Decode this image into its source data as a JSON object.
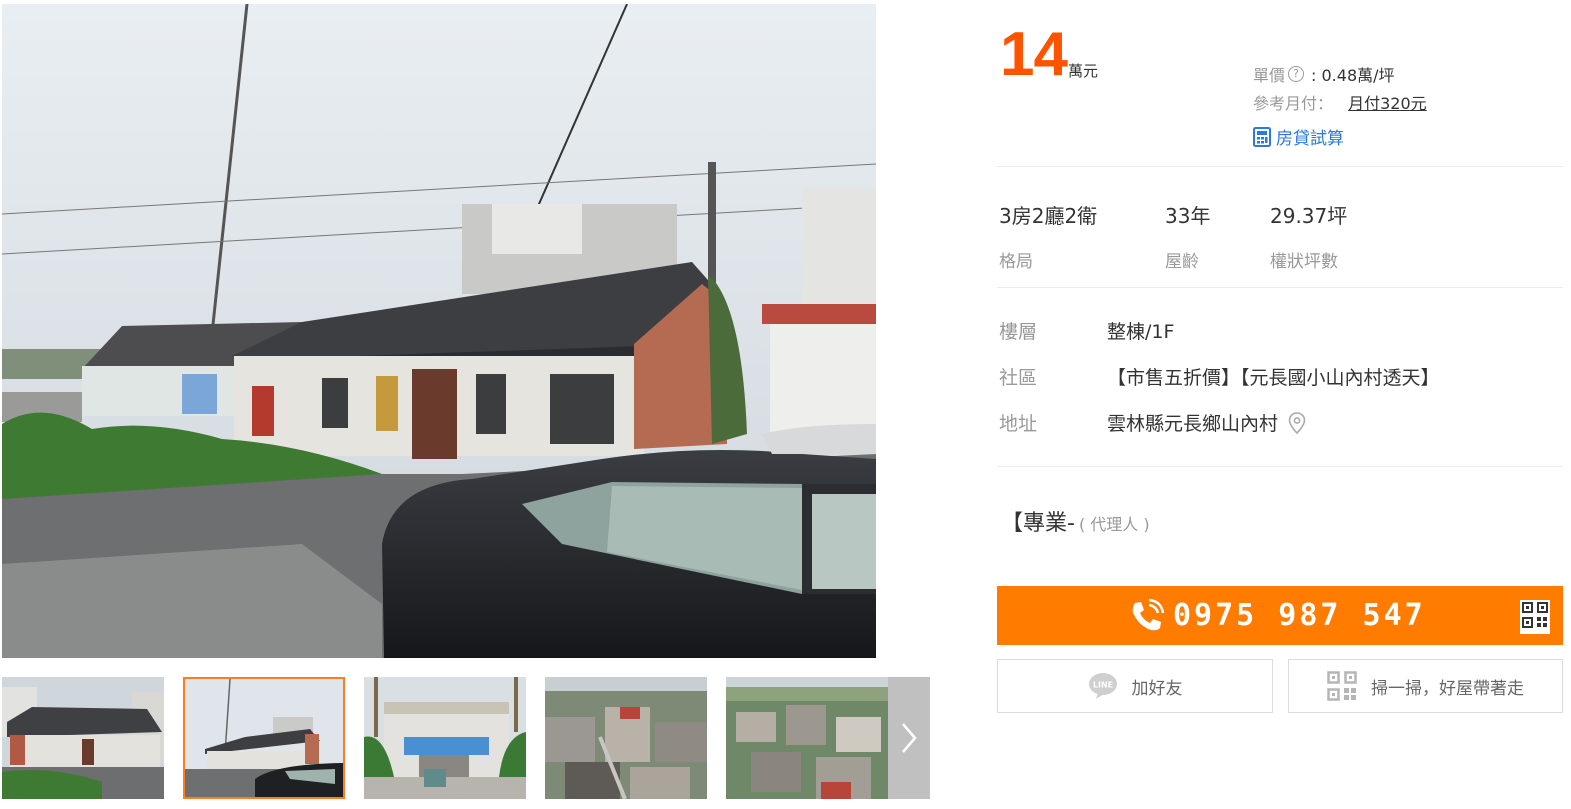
{
  "price": {
    "amount": "14",
    "unit": "萬元",
    "unit_price_label": "單價",
    "unit_price_value": ": 0.48萬/坪",
    "monthly_label": "參考月付：",
    "monthly_value": "月付320元",
    "loan_calc": "房貸試算"
  },
  "specs": [
    {
      "value": "3房2廳2衛",
      "label": "格局"
    },
    {
      "value": "33年",
      "label": "屋齡"
    },
    {
      "value": "29.37坪",
      "label": "權狀坪數"
    }
  ],
  "details": {
    "floor_label": "樓層",
    "floor_value": "整棟/1F",
    "community_label": "社區",
    "community_value": "【市售五折價】【元長國小山內村透天】",
    "address_label": "地址",
    "address_value": "雲林縣元長鄉山內村"
  },
  "agent": {
    "name": "【專業-",
    "role": "( 代理人 )"
  },
  "contact": {
    "phone": "0975 987 547",
    "line_button": "加好友",
    "scan_button": "掃一掃，好屋帶著走"
  },
  "colors": {
    "price": "#ff5300",
    "accent": "#ff7c00",
    "link": "#2b78e4"
  },
  "icons": [
    "help-icon",
    "calculator-icon",
    "map-pin-icon",
    "phone-icon",
    "qr-code-icon",
    "line-icon",
    "chevron-right-icon"
  ]
}
